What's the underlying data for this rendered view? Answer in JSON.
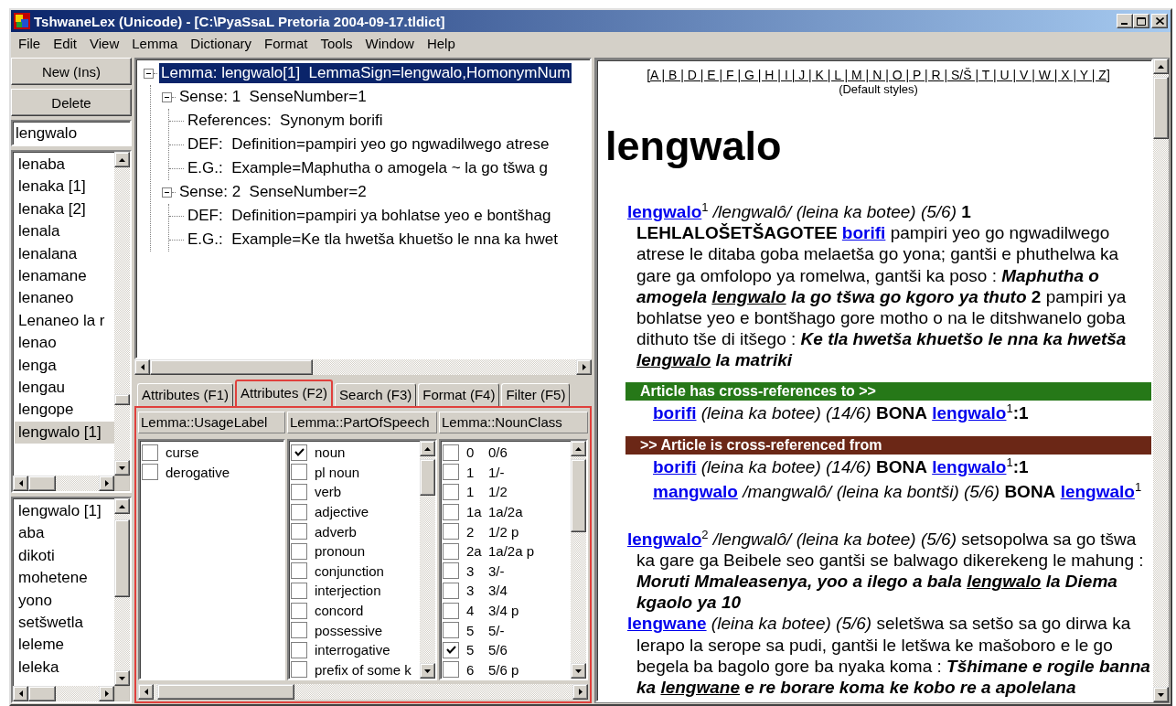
{
  "window": {
    "title": "TshwaneLex (Unicode) - [C:\\PyaSsaL Pretoria 2004-09-17.tldict]"
  },
  "menu": [
    "File",
    "Edit",
    "View",
    "Lemma",
    "Dictionary",
    "Format",
    "Tools",
    "Window",
    "Help"
  ],
  "side": {
    "buttons": [
      "New (Ins)",
      "Delete"
    ],
    "search": {
      "value": "lengwalo"
    },
    "lemma_list": [
      {
        "label": "lenaba",
        "selected": false
      },
      {
        "label": "lenaka [1]",
        "selected": false
      },
      {
        "label": "lenaka [2]",
        "selected": false
      },
      {
        "label": "lenala",
        "selected": false
      },
      {
        "label": "lenalana",
        "selected": false
      },
      {
        "label": "lenamane",
        "selected": false
      },
      {
        "label": "lenaneo",
        "selected": false
      },
      {
        "label": "Lenaneo la r",
        "selected": false
      },
      {
        "label": "lenao",
        "selected": false
      },
      {
        "label": "lenga",
        "selected": false
      },
      {
        "label": "lengau",
        "selected": false
      },
      {
        "label": "lengope",
        "selected": false
      },
      {
        "label": "lengwalo [1]",
        "selected": true
      }
    ],
    "history_list": [
      "lengwalo [1]",
      "aba",
      "dikoti",
      "mohetene",
      "yono",
      "setšwetla",
      "leleme",
      "leleka"
    ]
  },
  "tree": [
    {
      "label": "Lemma: lengwalo[1]  LemmaSign=lengwalo,HomonymNum",
      "selected": true,
      "expanded": true,
      "children": [
        {
          "label": "Sense: 1  SenseNumber=1",
          "selected": false,
          "expanded": true,
          "children": [
            {
              "label": "References:  Synonym borifi",
              "selected": false
            },
            {
              "label": "DEF:  Definition=pampiri yeo go ngwadilwego atrese",
              "selected": false
            },
            {
              "label": "E.G.:  Example=Maphutha o amogela ~ la go tšwa g",
              "selected": false
            }
          ]
        },
        {
          "label": "Sense: 2  SenseNumber=2",
          "selected": false,
          "expanded": true,
          "children": [
            {
              "label": "DEF:  Definition=pampiri ya bohlatse yeo e bontšhag",
              "selected": false
            },
            {
              "label": "E.G.:  Example=Ke tla hwetša khuetšo le nna ka hwet",
              "selected": false
            }
          ]
        }
      ]
    }
  ],
  "tabs": [
    {
      "label": "Attributes (F1)",
      "selected": false,
      "highlighted": false
    },
    {
      "label": "Attributes (F2)",
      "selected": true,
      "highlighted": true
    },
    {
      "label": "Search (F3)",
      "selected": false,
      "highlighted": false
    },
    {
      "label": "Format (F4)",
      "selected": false,
      "highlighted": false
    },
    {
      "label": "Filter (F5)",
      "selected": false,
      "highlighted": false
    }
  ],
  "attributes": {
    "highlighted": true,
    "columns": [
      {
        "header": "Lemma::UsageLabel",
        "kind": "plain",
        "scrollable": false,
        "items": [
          {
            "label": "curse",
            "checked": false
          },
          {
            "label": "derogative",
            "checked": false
          }
        ]
      },
      {
        "header": "Lemma::PartOfSpeech",
        "kind": "plain",
        "scrollable": true,
        "items": [
          {
            "label": "noun",
            "checked": true
          },
          {
            "label": "pl noun",
            "checked": false
          },
          {
            "label": "verb",
            "checked": false
          },
          {
            "label": "adjective",
            "checked": false
          },
          {
            "label": "adverb",
            "checked": false
          },
          {
            "label": "pronoun",
            "checked": false
          },
          {
            "label": "conjunction",
            "checked": false
          },
          {
            "label": "interjection",
            "checked": false
          },
          {
            "label": "concord",
            "checked": false
          },
          {
            "label": "possessive",
            "checked": false
          },
          {
            "label": "interrogative",
            "checked": false
          },
          {
            "label": "prefix of some k",
            "checked": false
          }
        ]
      },
      {
        "header": "Lemma::NounClass",
        "kind": "coded",
        "scrollable": true,
        "items": [
          {
            "code": "0",
            "label": "0/6",
            "checked": false
          },
          {
            "code": "1",
            "label": "1/-",
            "checked": false
          },
          {
            "code": "1",
            "label": "1/2",
            "checked": false
          },
          {
            "code": "1a",
            "label": "1a/2a",
            "checked": false
          },
          {
            "code": "2",
            "label": "1/2 p",
            "checked": false
          },
          {
            "code": "2a",
            "label": "1a/2a p",
            "checked": false
          },
          {
            "code": "3",
            "label": "3/-",
            "checked": false
          },
          {
            "code": "3",
            "label": "3/4",
            "checked": false
          },
          {
            "code": "4",
            "label": "3/4 p",
            "checked": false
          },
          {
            "code": "5",
            "label": "5/-",
            "checked": false
          },
          {
            "code": "5",
            "label": "5/6",
            "checked": true
          },
          {
            "code": "6",
            "label": "5/6 p",
            "checked": false
          }
        ]
      }
    ]
  },
  "article": {
    "alphabet": "[A | B | D | E | F | G | H | I | J | K | L | M | N | O | P | R | S/Š | T | U | V | W | X | Y | Z]",
    "styles_note": "(Default styles)",
    "headword": "lengwalo",
    "blocks": [
      {
        "kind": "entry",
        "runs": [
          {
            "kind": "link",
            "text": "lengwalo"
          },
          {
            "kind": "text",
            "text": "$^{1}$ */lengwalô/ (leina ka botee) (5/6)* **1** **LEHLALOŠETŠAGOTEE** "
          },
          {
            "kind": "link",
            "text": "borifi"
          },
          {
            "kind": "text",
            "text": " pampiri yeo go ngwadilwego atrese le ditaba goba melaetša go yona; gantši e phuthelwa ka gare ga omfolopo ya romelwa, gantši ka poso : "
          },
          {
            "kind": "example",
            "text": "Maphutha o amogela "
          },
          {
            "kind": "example_ref",
            "text": "lengwalo"
          },
          {
            "kind": "example",
            "text": " la go tšwa go kgoro ya thuto"
          },
          {
            "kind": "text",
            "text": " **2** pampiri ya bohlatse yeo e bontšhago gore motho o na le ditshwanelo goba dithuto tše di itšego : "
          },
          {
            "kind": "example",
            "text": "Ke tla hwetša khuetšo le nna ka hwetša "
          },
          {
            "kind": "example_ref",
            "text": "lengwalo"
          },
          {
            "kind": "example",
            "text": " la matriki"
          }
        ]
      },
      {
        "kind": "xref",
        "title": "Article has cross-references to >>",
        "color": "#267818",
        "rows": [
          {
            "runs": [
              {
                "kind": "link",
                "text": "borifi"
              },
              {
                "kind": "text",
                "text": " *(leina ka botee) (14/6)* **BONA** "
              },
              {
                "kind": "link",
                "text": "lengwalo"
              },
              {
                "kind": "text",
                "text": "$^{1}$**:1**"
              }
            ]
          }
        ]
      },
      {
        "kind": "xref",
        "title": ">> Article is cross-referenced from",
        "color": "#6b2716",
        "rows": [
          {
            "runs": [
              {
                "kind": "link",
                "text": "borifi"
              },
              {
                "kind": "text",
                "text": " *(leina ka botee) (14/6)* **BONA** "
              },
              {
                "kind": "link",
                "text": "lengwalo"
              },
              {
                "kind": "text",
                "text": "$^{1}$**:1**"
              }
            ]
          },
          {
            "runs": [
              {
                "kind": "link",
                "text": "mangwalo"
              },
              {
                "kind": "text",
                "text": " */mangwalô/ (leina ka bontši) (5/6)* **BONA** "
              },
              {
                "kind": "link",
                "text": "lengwalo"
              },
              {
                "kind": "text",
                "text": "$^{1}$"
              }
            ]
          }
        ]
      },
      {
        "kind": "entry",
        "runs": [
          {
            "kind": "link",
            "text": "lengwalo"
          },
          {
            "kind": "text",
            "text": "$^{2}$ */lengwalô/ (leina ka botee) (5/6)* setsopolwa sa go tšwa ka gare ga Beibele seo gantši se balwago dikerekeng le mahung : "
          },
          {
            "kind": "example",
            "text": "Moruti Mmaleasenya, yoo a ilego a bala "
          },
          {
            "kind": "example_ref",
            "text": "lengwalo"
          },
          {
            "kind": "example",
            "text": " la Diema kgaolo ya 10"
          }
        ]
      },
      {
        "kind": "entry",
        "runs": [
          {
            "kind": "link",
            "text": "lengwane"
          },
          {
            "kind": "text",
            "text": " *(leina ka botee) (5/6)* seletšwa sa setšo sa go dirwa ka lerapo la serope sa pudi, gantši le letšwa ke mašoboro e le go begela ba bagolo gore ba nyaka koma : "
          },
          {
            "kind": "example",
            "text": "Tšhimane e rogile banna ka "
          },
          {
            "kind": "example_ref",
            "text": "lengwane"
          },
          {
            "kind": "example",
            "text": " e re borare koma ke kobo re a apolelana"
          }
        ]
      }
    ]
  }
}
